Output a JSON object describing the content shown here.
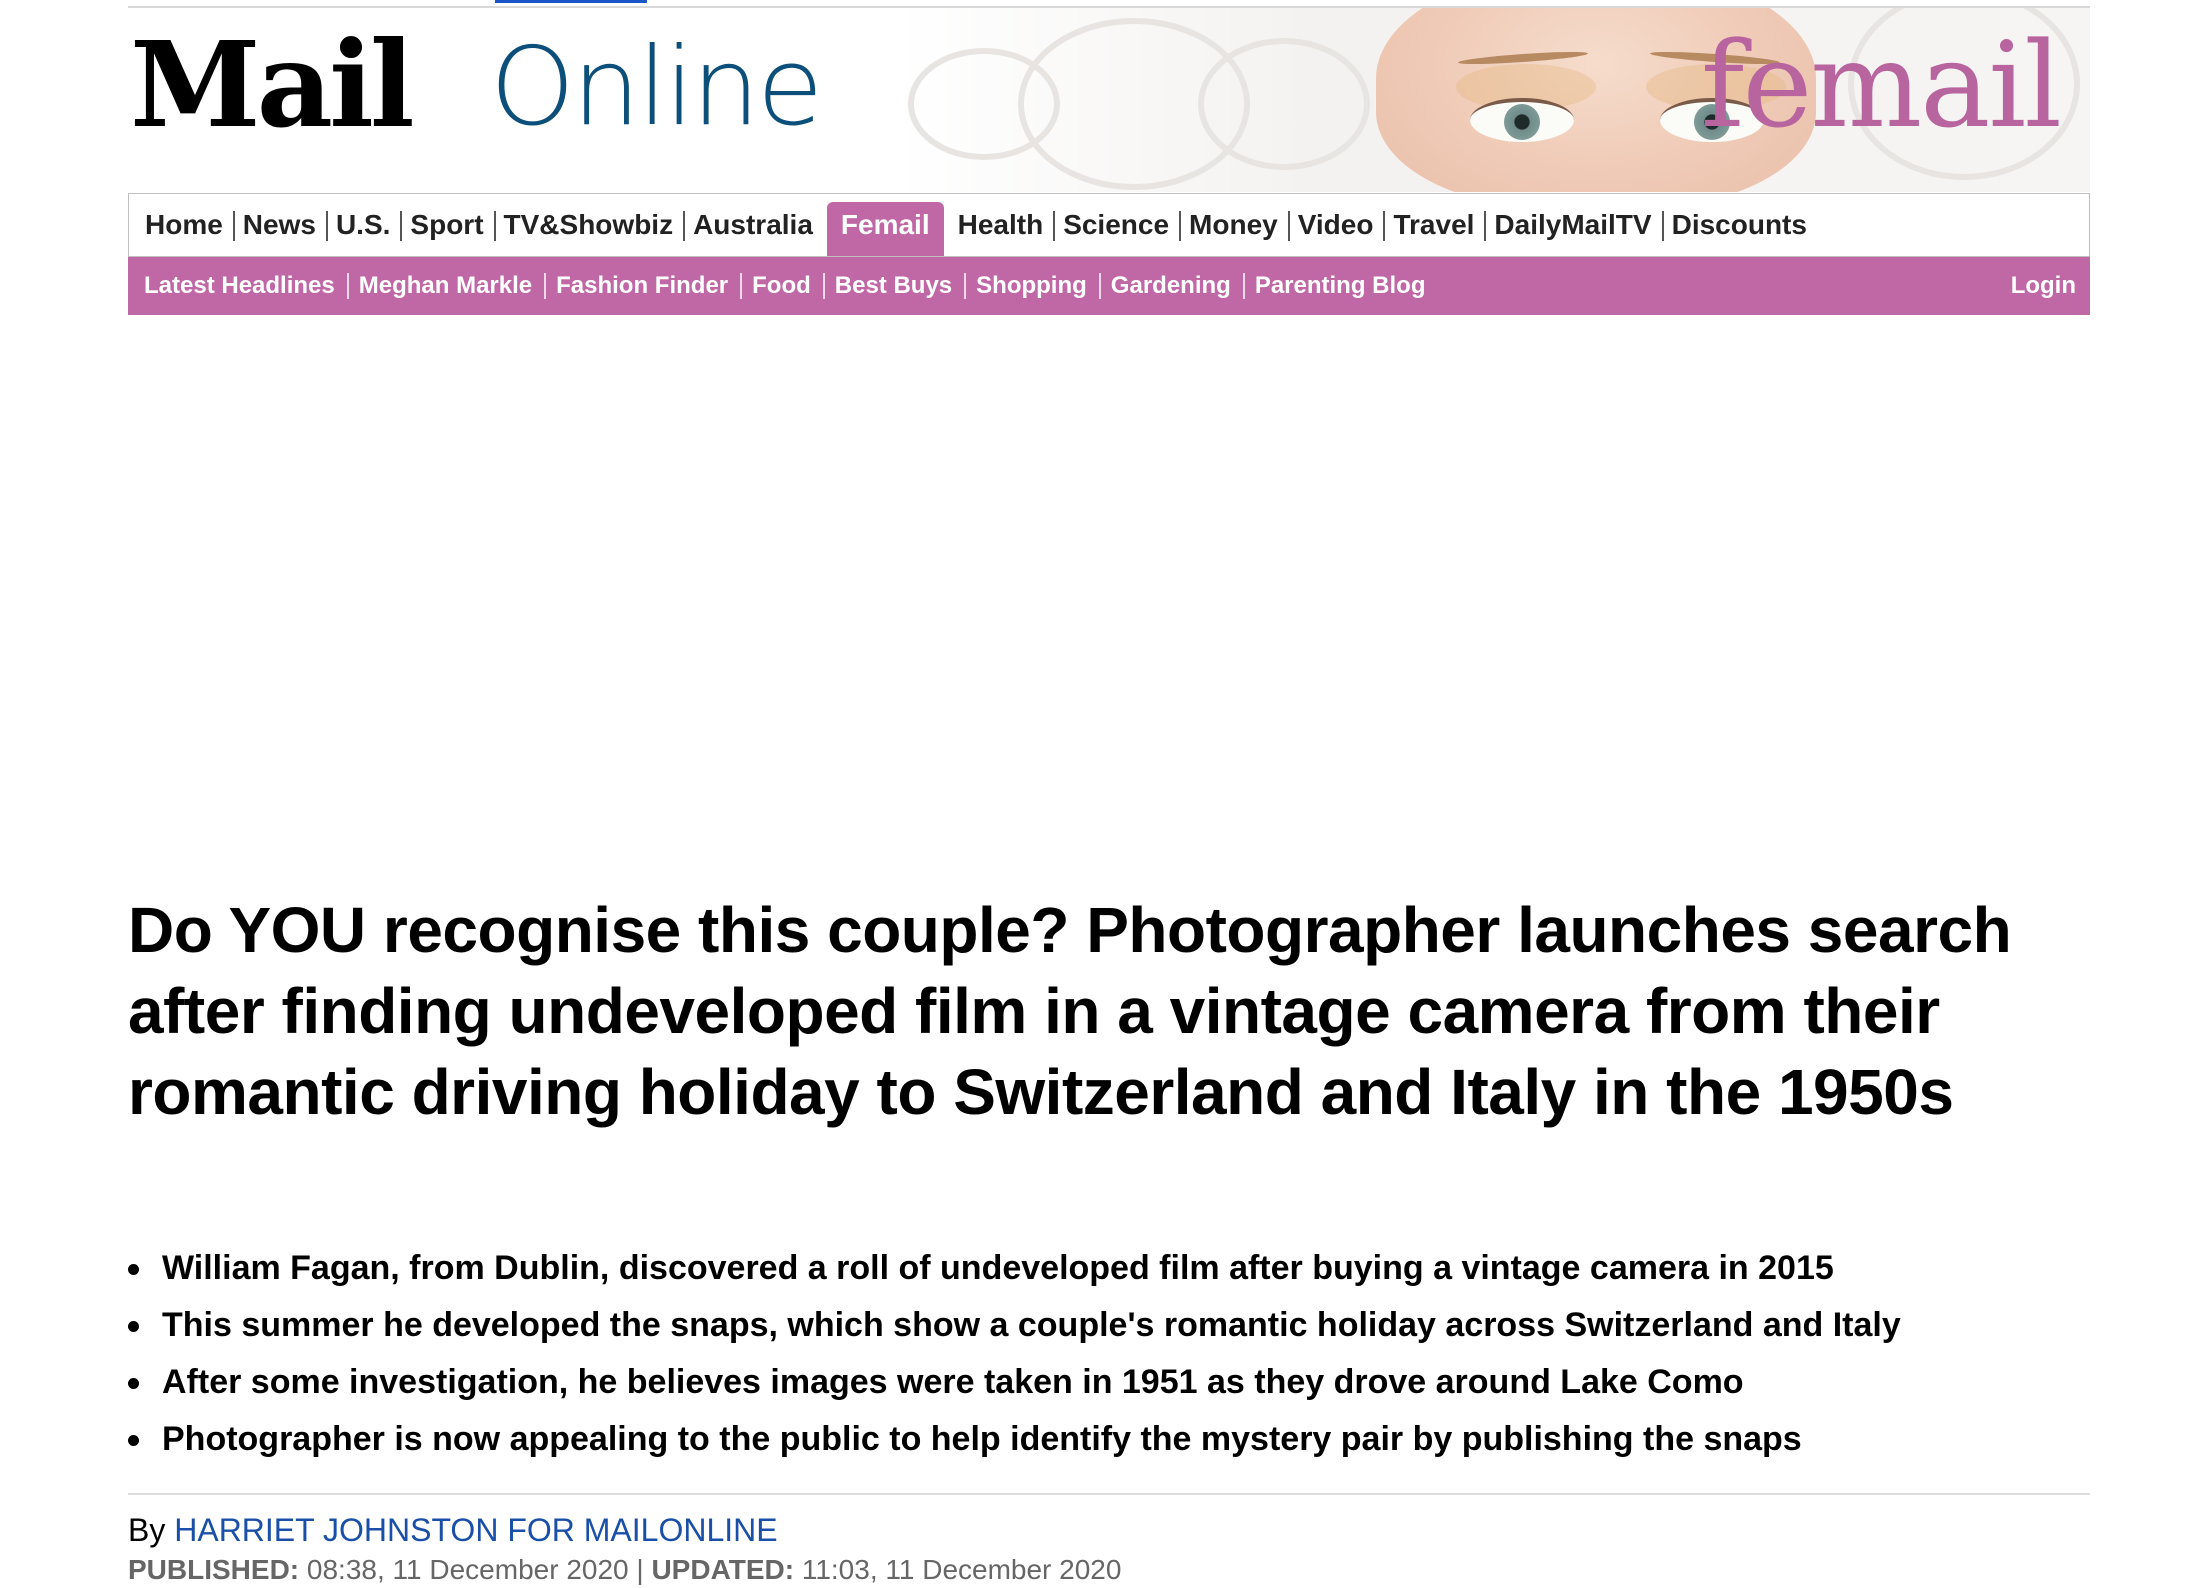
{
  "masthead": {
    "logo_mail": "Mail",
    "logo_online": "Online",
    "section_title": "femail"
  },
  "colors": {
    "accent_pink": "#c068a6",
    "link_blue": "#1a4fa8",
    "online_blue": "#0b4f7a"
  },
  "main_nav": {
    "items": [
      {
        "label": "Home"
      },
      {
        "label": "News"
      },
      {
        "label": "U.S."
      },
      {
        "label": "Sport"
      },
      {
        "label": "TV&Showbiz"
      },
      {
        "label": "Australia"
      },
      {
        "label": "Femail",
        "active": true
      },
      {
        "label": "Health"
      },
      {
        "label": "Science"
      },
      {
        "label": "Money"
      },
      {
        "label": "Video"
      },
      {
        "label": "Travel"
      },
      {
        "label": "DailyMailTV"
      },
      {
        "label": "Discounts"
      }
    ]
  },
  "sub_nav": {
    "items": [
      {
        "label": "Latest Headlines"
      },
      {
        "label": "Meghan Markle"
      },
      {
        "label": "Fashion Finder"
      },
      {
        "label": "Food"
      },
      {
        "label": "Best Buys"
      },
      {
        "label": "Shopping"
      },
      {
        "label": "Gardening"
      },
      {
        "label": "Parenting Blog"
      }
    ],
    "login_label": "Login"
  },
  "article": {
    "headline": "Do YOU recognise this couple? Photographer launches search after finding undeveloped film in a vintage camera from their romantic driving holiday to Switzerland and Italy in the 1950s",
    "bullets": [
      "William Fagan, from Dublin, discovered a roll of undeveloped film after buying a vintage camera in 2015",
      "This summer he developed the snaps, which show a couple's romantic holiday across Switzerland and Italy",
      "After some investigation, he believes images were taken in  1951 as they drove around Lake Como",
      "Photographer is now appealing to the public to help identify the mystery pair by publishing the snaps"
    ],
    "byline_prefix": "By ",
    "author": "HARRIET JOHNSTON FOR MAILONLINE",
    "published_label": "PUBLISHED:",
    "published_value": " 08:38, 11 December 2020",
    "separator": " | ",
    "updated_label": "UPDATED:",
    "updated_value": " 11:03, 11 December 2020"
  }
}
